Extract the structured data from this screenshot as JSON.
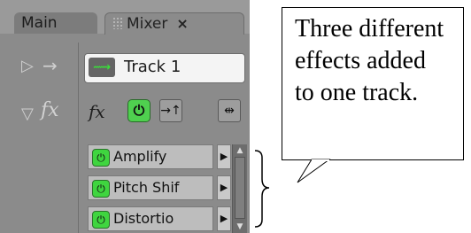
{
  "tabs": [
    {
      "label": "Main"
    },
    {
      "label": "Mixer",
      "close": "×"
    }
  ],
  "left_controls": {
    "expand_arrow": "▷",
    "route_arrow": "→",
    "fx_toggle": "▽",
    "fx_label": "fx"
  },
  "track": {
    "icon": "waveform-icon",
    "name": "Track 1"
  },
  "fx_toolbar": {
    "fx_label": "fx",
    "power_icon": "power-icon",
    "insert_icon": "insert-icon",
    "routing_icon": "routing-icon"
  },
  "effects": [
    {
      "name": "Amplify",
      "power": "on"
    },
    {
      "name": "Pitch Shif",
      "power": "on"
    },
    {
      "name": "Distortio",
      "power": "on"
    }
  ],
  "callout": {
    "text": "Three different effects added to one track."
  },
  "colors": {
    "panel_bg": "#8b8b8b",
    "power_green": "#3fd53f",
    "callout_border": "#000000"
  }
}
